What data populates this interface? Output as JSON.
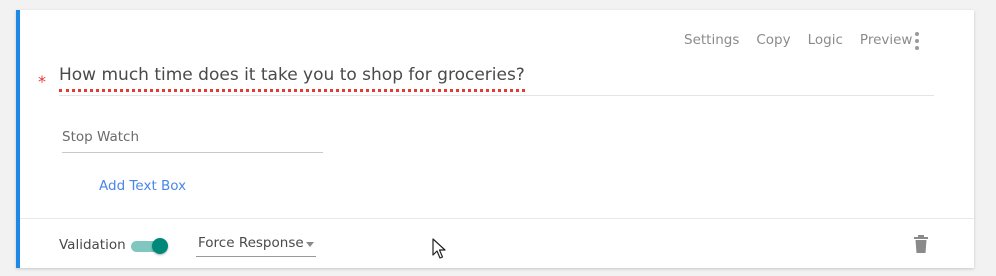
{
  "toolbar": {
    "settings": "Settings",
    "copy": "Copy",
    "logic": "Logic",
    "preview": "Preview",
    "more_icon": "kebab-menu-icon"
  },
  "question": {
    "required_marker": "*",
    "text": "How much time does it take you to shop for groceries?"
  },
  "answer": {
    "field_text": "Stop Watch",
    "add_text_box": "Add Text Box"
  },
  "footer": {
    "validation_label": "Validation",
    "validation_enabled": true,
    "response_option": "Force Response",
    "delete_icon": "trash-icon"
  },
  "colors": {
    "accent_border": "#1e88e5",
    "required": "#e53935",
    "toggle_on": "#00897b",
    "link": "#4a86e8"
  }
}
